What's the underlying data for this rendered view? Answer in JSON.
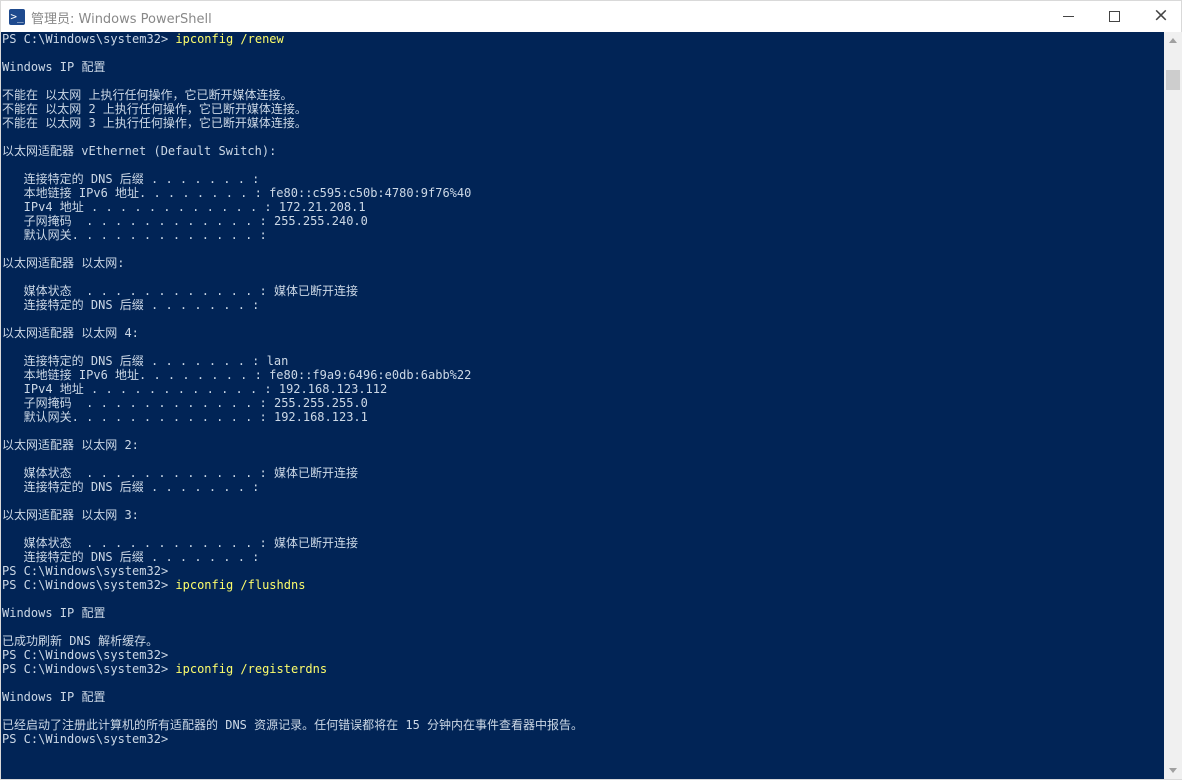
{
  "window": {
    "title": "管理员: Windows PowerShell",
    "icon": "powershell-icon",
    "controls": {
      "minimize": "minimize-icon",
      "maximize": "maximize-icon",
      "close": "close-icon"
    },
    "colors": {
      "console_background": "#012456",
      "console_text": "#ccd8e6",
      "command_text": "#fdfd6b"
    }
  },
  "console": {
    "lines": [
      {
        "prompt": "PS C:\\Windows\\system32> ",
        "command": "ipconfig /renew"
      },
      {
        "text": ""
      },
      {
        "text": "Windows IP 配置"
      },
      {
        "text": ""
      },
      {
        "text": "不能在 以太网 上执行任何操作，它已断开媒体连接。"
      },
      {
        "text": "不能在 以太网 2 上执行任何操作，它已断开媒体连接。"
      },
      {
        "text": "不能在 以太网 3 上执行任何操作，它已断开媒体连接。"
      },
      {
        "text": ""
      },
      {
        "text": "以太网适配器 vEthernet (Default Switch):"
      },
      {
        "text": ""
      },
      {
        "text": "   连接特定的 DNS 后缀 . . . . . . . :"
      },
      {
        "text": "   本地链接 IPv6 地址. . . . . . . . : fe80::c595:c50b:4780:9f76%40"
      },
      {
        "text": "   IPv4 地址 . . . . . . . . . . . . : 172.21.208.1"
      },
      {
        "text": "   子网掩码  . . . . . . . . . . . . : 255.255.240.0"
      },
      {
        "text": "   默认网关. . . . . . . . . . . . . :"
      },
      {
        "text": ""
      },
      {
        "text": "以太网适配器 以太网:"
      },
      {
        "text": ""
      },
      {
        "text": "   媒体状态  . . . . . . . . . . . . : 媒体已断开连接"
      },
      {
        "text": "   连接特定的 DNS 后缀 . . . . . . . :"
      },
      {
        "text": ""
      },
      {
        "text": "以太网适配器 以太网 4:"
      },
      {
        "text": ""
      },
      {
        "text": "   连接特定的 DNS 后缀 . . . . . . . : lan"
      },
      {
        "text": "   本地链接 IPv6 地址. . . . . . . . : fe80::f9a9:6496:e0db:6abb%22"
      },
      {
        "text": "   IPv4 地址 . . . . . . . . . . . . : 192.168.123.112"
      },
      {
        "text": "   子网掩码  . . . . . . . . . . . . : 255.255.255.0"
      },
      {
        "text": "   默认网关. . . . . . . . . . . . . : 192.168.123.1"
      },
      {
        "text": ""
      },
      {
        "text": "以太网适配器 以太网 2:"
      },
      {
        "text": ""
      },
      {
        "text": "   媒体状态  . . . . . . . . . . . . : 媒体已断开连接"
      },
      {
        "text": "   连接特定的 DNS 后缀 . . . . . . . :"
      },
      {
        "text": ""
      },
      {
        "text": "以太网适配器 以太网 3:"
      },
      {
        "text": ""
      },
      {
        "text": "   媒体状态  . . . . . . . . . . . . : 媒体已断开连接"
      },
      {
        "text": "   连接特定的 DNS 后缀 . . . . . . . :"
      },
      {
        "prompt": "PS C:\\Windows\\system32>"
      },
      {
        "prompt": "PS C:\\Windows\\system32> ",
        "command": "ipconfig /flushdns"
      },
      {
        "text": ""
      },
      {
        "text": "Windows IP 配置"
      },
      {
        "text": ""
      },
      {
        "text": "已成功刷新 DNS 解析缓存。"
      },
      {
        "prompt": "PS C:\\Windows\\system32>"
      },
      {
        "prompt": "PS C:\\Windows\\system32> ",
        "command": "ipconfig /registerdns"
      },
      {
        "text": ""
      },
      {
        "text": "Windows IP 配置"
      },
      {
        "text": ""
      },
      {
        "text": "已经启动了注册此计算机的所有适配器的 DNS 资源记录。任何错误都将在 15 分钟内在事件查看器中报告。"
      },
      {
        "prompt": "PS C:\\Windows\\system32>"
      }
    ]
  }
}
